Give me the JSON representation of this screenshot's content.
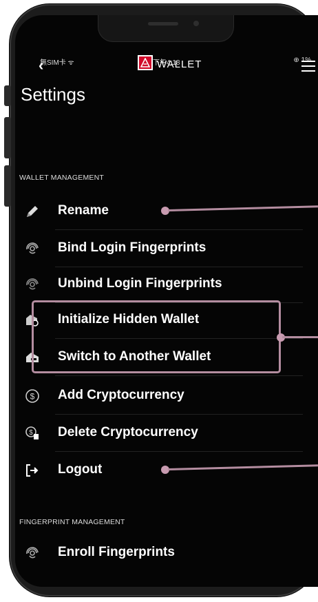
{
  "status": {
    "carrier": "無SIM卡 ᯤ",
    "time": "下午4:18",
    "battery": "⊕ 1%"
  },
  "nav": {
    "back": "‹",
    "brand": "WALLET"
  },
  "page": {
    "title": "Settings"
  },
  "sections": {
    "wallet": "WALLET MANAGEMENT",
    "fingerprint": "FINGERPRINT MANAGEMENT"
  },
  "items": [
    {
      "label": "Rename",
      "icon": "pencil-icon"
    },
    {
      "label": "Bind Login Fingerprints",
      "icon": "fingerprint-icon"
    },
    {
      "label": "Unbind Login Fingerprints",
      "icon": "fingerprint-off-icon"
    },
    {
      "label": "Initialize Hidden Wallet",
      "icon": "hidden-wallet-icon"
    },
    {
      "label": "Switch to Another Wallet",
      "icon": "switch-wallet-icon"
    },
    {
      "label": "Add Cryptocurrency",
      "icon": "coin-add-icon"
    },
    {
      "label": "Delete Cryptocurrency",
      "icon": "coin-delete-icon"
    },
    {
      "label": "Logout",
      "icon": "logout-icon"
    },
    {
      "label": "Enroll Fingerprints",
      "icon": "fingerprint-enroll-icon"
    }
  ],
  "colors": {
    "accent": "#b48da0",
    "brand": "#d10a2a",
    "background": "#050505"
  }
}
